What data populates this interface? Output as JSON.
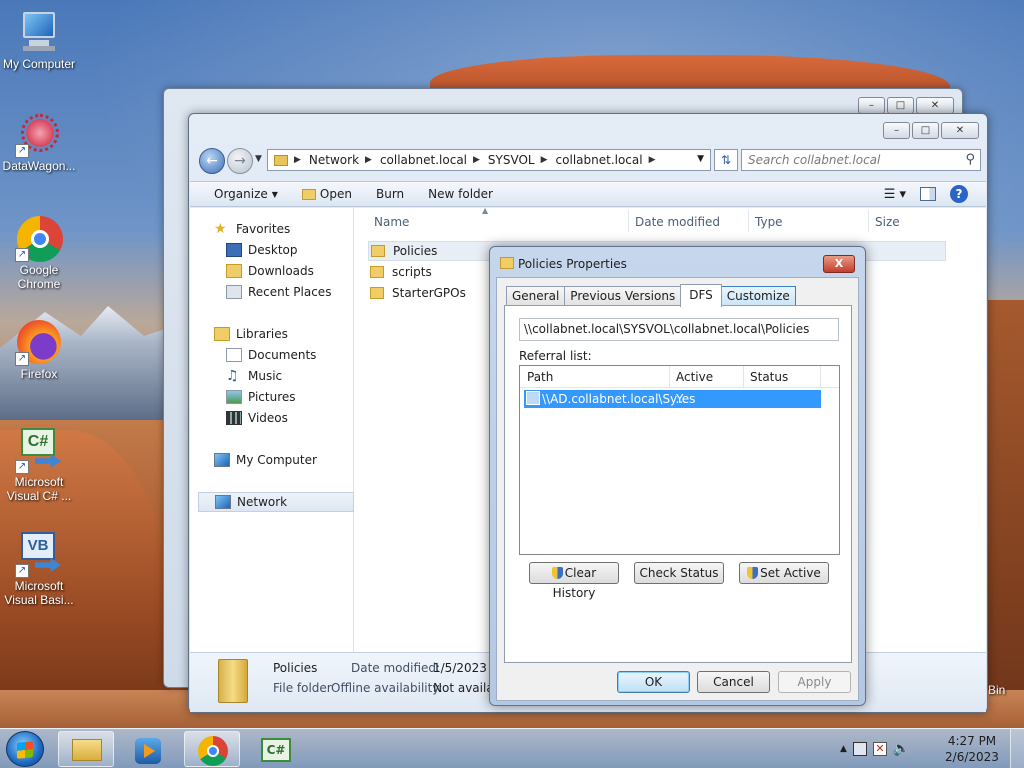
{
  "desktop": {
    "icons": [
      {
        "label": "My Computer"
      },
      {
        "label": "DataWagon..."
      },
      {
        "label": "Google Chrome"
      },
      {
        "label": "Firefox"
      },
      {
        "label": "Microsoft Visual C# ..."
      },
      {
        "label": "Microsoft Visual Basi..."
      }
    ],
    "recycle_bin_label": "Bin"
  },
  "explorer": {
    "address": {
      "crumbs": [
        "Network",
        "collabnet.local",
        "SYSVOL",
        "collabnet.local"
      ]
    },
    "search_placeholder": "Search collabnet.local",
    "toolbar": {
      "organize": "Organize",
      "open": "Open",
      "burn": "Burn",
      "new_folder": "New folder"
    },
    "navpane": {
      "favorites": "Favorites",
      "desktop": "Desktop",
      "downloads": "Downloads",
      "recent": "Recent Places",
      "libraries": "Libraries",
      "documents": "Documents",
      "music": "Music",
      "pictures": "Pictures",
      "videos": "Videos",
      "my_computer": "My Computer",
      "network": "Network"
    },
    "columns": {
      "name": "Name",
      "date": "Date modified",
      "type": "Type",
      "size": "Size"
    },
    "files": [
      "Policies",
      "scripts",
      "StarterGPOs"
    ],
    "details": {
      "name": "Policies",
      "type": "File folder",
      "date_label": "Date modified:",
      "date_value": "1/5/2023 2",
      "offline_label": "Offline availability:",
      "offline_value": "Not availal"
    }
  },
  "dialog": {
    "title": "Policies Properties",
    "close": "X",
    "tabs": [
      "General",
      "Previous Versions",
      "DFS",
      "Customize"
    ],
    "active_tab": "DFS",
    "path": "\\\\collabnet.local\\SYSVOL\\collabnet.local\\Policies",
    "referral_label": "Referral list:",
    "columns": {
      "path": "Path",
      "active": "Active",
      "status": "Status"
    },
    "rows": [
      {
        "path": "\\\\AD.collabnet.local\\Sy...",
        "active": "Yes",
        "status": ""
      }
    ],
    "buttons": {
      "clear_history": "Clear History",
      "check_status": "Check Status",
      "set_active": "Set Active",
      "ok": "OK",
      "cancel": "Cancel",
      "apply": "Apply"
    }
  },
  "taskbar": {
    "time": "4:27 PM",
    "date": "2/6/2023"
  }
}
